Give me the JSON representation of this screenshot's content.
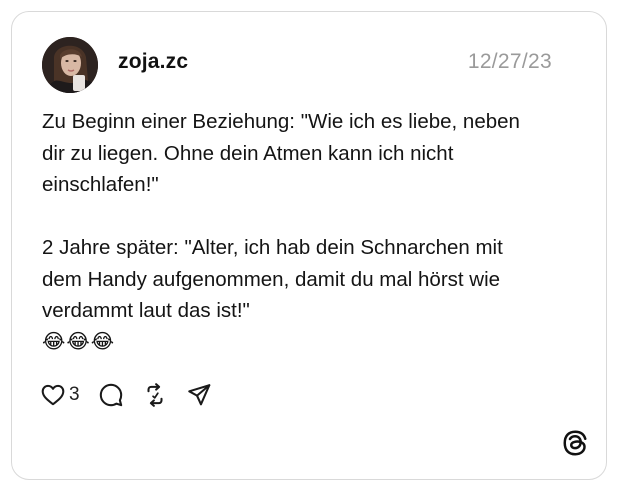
{
  "post": {
    "username": "zoja.zc",
    "date": "12/27/23",
    "text_paragraph_1_lines": [
      "Zu Beginn einer Beziehung: \"Wie ich es liebe, neben",
      "dir zu liegen. Ohne dein Atmen kann ich nicht",
      "einschlafen!\""
    ],
    "text_paragraph_2_lines": [
      "2 Jahre später: \"Alter, ich hab dein Schnarchen mit",
      "dem Handy aufgenommen, damit du mal hörst wie",
      "verdammt laut das ist!\""
    ],
    "emojis": "😂😂😂",
    "like_count": "3"
  },
  "icons": {
    "like": "heart-icon",
    "reply": "comment-bubble-icon",
    "repost": "repost-icon",
    "share": "send-icon",
    "brand": "threads-logo-icon"
  },
  "colors": {
    "text": "#141414",
    "date": "#9a9a9a",
    "border": "#d9d9d9"
  }
}
